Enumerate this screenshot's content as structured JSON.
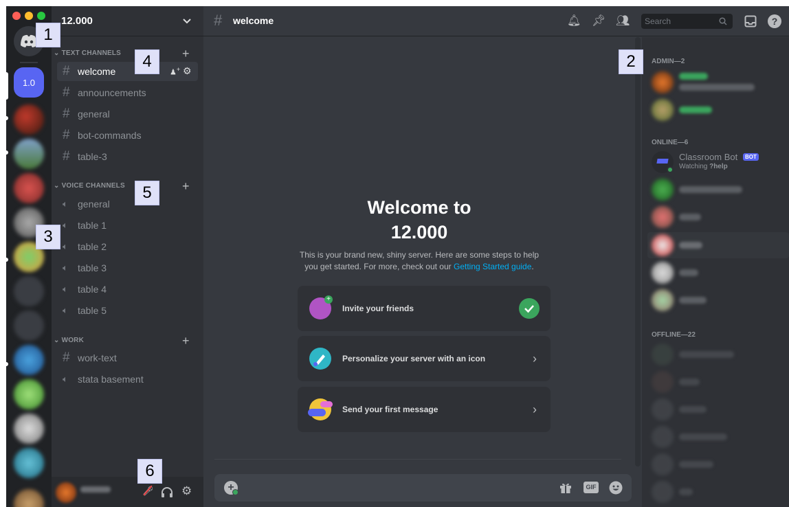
{
  "server": {
    "name": "12.000",
    "selected_badge": "1.0"
  },
  "header": {
    "channel": "welcome",
    "search_placeholder": "Search"
  },
  "categories": {
    "text": "TEXT CHANNELS",
    "voice": "VOICE CHANNELS",
    "work": "WORK"
  },
  "text_channels": [
    "welcome",
    "announcements",
    "general",
    "bot-commands",
    "table-3"
  ],
  "voice_channels": [
    "general",
    "table 1",
    "table 2",
    "table 3",
    "table 4",
    "table 5"
  ],
  "work_channels": [
    {
      "name": "work-text",
      "type": "text"
    },
    {
      "name": "stata basement",
      "type": "voice"
    }
  ],
  "welcome": {
    "title_line1": "Welcome to",
    "title_line2": "12.000",
    "desc_line1": "This is your brand new, shiny server. Here are some steps to help",
    "desc_line2": "you get started. For more, check out our ",
    "desc_link": "Getting Started guide",
    "desc_end": "."
  },
  "steps": [
    {
      "label": "Invite your friends",
      "status": "done"
    },
    {
      "label": "Personalize your server with an icon",
      "status": "pending"
    },
    {
      "label": "Send your first message",
      "status": "pending"
    }
  ],
  "members": {
    "admin_header": "ADMIN—2",
    "online_header": "ONLINE—6",
    "offline_header": "OFFLINE—22",
    "bot": {
      "name": "Classroom Bot",
      "tag": "BOT",
      "activity_prefix": "Watching ",
      "activity_cmd": "?help"
    }
  },
  "annotations": [
    "1",
    "2",
    "3",
    "4",
    "5",
    "6"
  ],
  "colors": {
    "blurple": "#5865f2",
    "link": "#00aff4",
    "green": "#3ba55d",
    "bg_main": "#36393f"
  }
}
